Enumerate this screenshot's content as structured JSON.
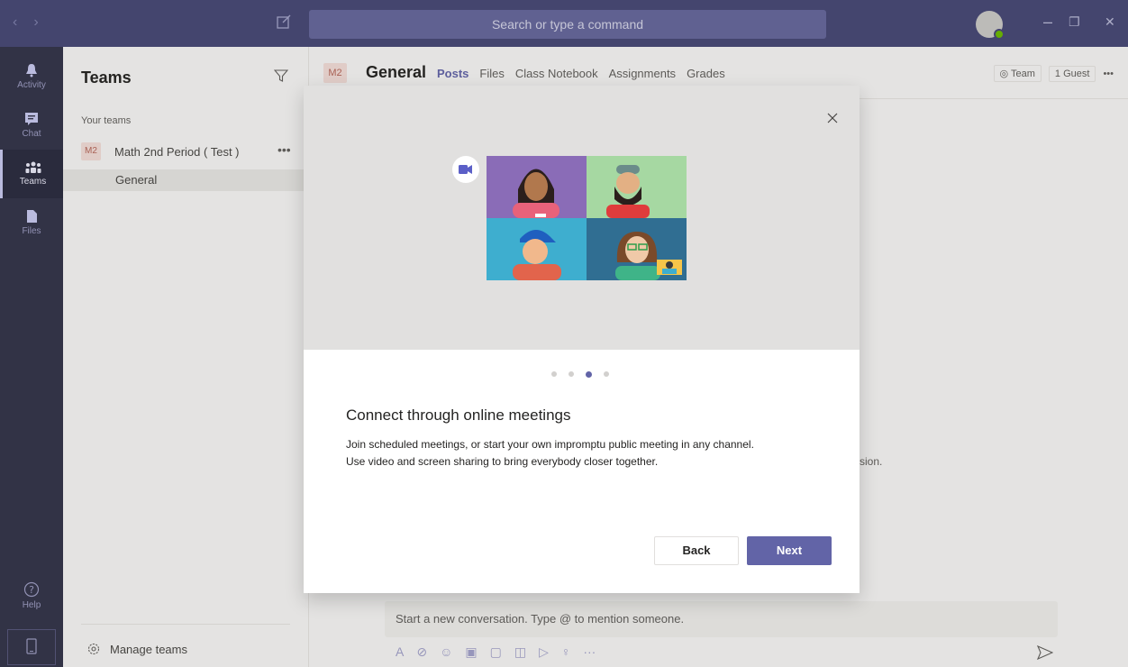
{
  "titlebar": {
    "search_placeholder": "Search or type a command"
  },
  "rail": {
    "items": [
      {
        "label": "Activity",
        "icon": "bell-icon"
      },
      {
        "label": "Chat",
        "icon": "chat-icon"
      },
      {
        "label": "Teams",
        "icon": "teams-icon"
      },
      {
        "label": "Files",
        "icon": "file-icon"
      }
    ],
    "help_label": "Help"
  },
  "panel": {
    "title": "Teams",
    "your_teams_label": "Your teams",
    "team_badge": "M2",
    "team_name": "Math 2nd Period ( Test )",
    "team_more": "•••",
    "channel_name": "General",
    "manage_label": "Manage teams"
  },
  "main": {
    "channel_badge": "M2",
    "channel_title": "General",
    "tabs": [
      "Posts",
      "Files",
      "Class Notebook",
      "Assignments",
      "Grades"
    ],
    "team_pill": "Team",
    "guest_pill": "1 Guest",
    "more": "•••",
    "bg_fragment": "sion.",
    "compose_placeholder": "Start a new conversation. Type @ to mention someone."
  },
  "modal": {
    "title": "Connect through online meetings",
    "desc_line1": "Join scheduled meetings, or start your own impromptu public meeting in any channel.",
    "desc_line2": "Use video and screen sharing to bring everybody closer together.",
    "back_label": "Back",
    "next_label": "Next",
    "page_total": 4,
    "page_current": 3
  },
  "colors": {
    "titlebar": "#464775",
    "rail": "#33344a",
    "accent": "#6264a7"
  }
}
